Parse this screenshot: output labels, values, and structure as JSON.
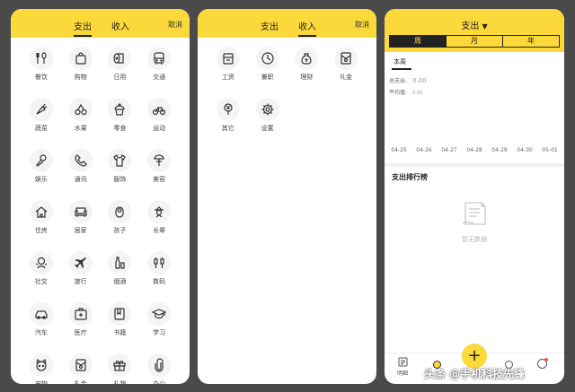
{
  "screen1": {
    "tabs": [
      "支出",
      "收入"
    ],
    "cancel": "取消",
    "categories": [
      {
        "label": "餐饮",
        "icon": "fork-spoon-icon"
      },
      {
        "label": "购物",
        "icon": "shopping-bag-icon"
      },
      {
        "label": "日用",
        "icon": "toilet-paper-icon"
      },
      {
        "label": "交通",
        "icon": "bus-icon"
      },
      {
        "label": "蔬菜",
        "icon": "carrot-icon"
      },
      {
        "label": "水果",
        "icon": "cherries-icon"
      },
      {
        "label": "零食",
        "icon": "cupcake-icon"
      },
      {
        "label": "运动",
        "icon": "bicycle-icon"
      },
      {
        "label": "娱乐",
        "icon": "microphone-icon"
      },
      {
        "label": "通讯",
        "icon": "phone-icon"
      },
      {
        "label": "服饰",
        "icon": "tshirt-icon"
      },
      {
        "label": "美容",
        "icon": "cosmetics-icon"
      },
      {
        "label": "住房",
        "icon": "house-icon"
      },
      {
        "label": "居家",
        "icon": "sofa-icon"
      },
      {
        "label": "孩子",
        "icon": "baby-icon"
      },
      {
        "label": "长辈",
        "icon": "elder-icon"
      },
      {
        "label": "社交",
        "icon": "people-icon"
      },
      {
        "label": "旅行",
        "icon": "airplane-icon"
      },
      {
        "label": "烟酒",
        "icon": "bottle-icon"
      },
      {
        "label": "数码",
        "icon": "usb-plug-icon"
      },
      {
        "label": "汽车",
        "icon": "car-icon"
      },
      {
        "label": "医疗",
        "icon": "medical-kit-icon"
      },
      {
        "label": "书籍",
        "icon": "book-icon"
      },
      {
        "label": "学习",
        "icon": "graduation-cap-icon"
      },
      {
        "label": "宠物",
        "icon": "pet-icon"
      },
      {
        "label": "礼金",
        "icon": "red-envelope-icon"
      },
      {
        "label": "礼物",
        "icon": "gift-icon"
      },
      {
        "label": "办公",
        "icon": "paperclip-icon"
      }
    ]
  },
  "screen2": {
    "tabs": [
      "支出",
      "收入"
    ],
    "cancel": "取消",
    "categories": [
      {
        "label": "工资",
        "icon": "wallet-icon"
      },
      {
        "label": "兼职",
        "icon": "clock-icon"
      },
      {
        "label": "理财",
        "icon": "money-bag-icon"
      },
      {
        "label": "礼金",
        "icon": "red-envelope-icon"
      },
      {
        "label": "其它",
        "icon": "coin-tag-icon"
      },
      {
        "label": "设置",
        "icon": "gear-icon"
      }
    ]
  },
  "screen3": {
    "title": "支出",
    "period_tabs": [
      "周",
      "月",
      "年"
    ],
    "period_label": "本周",
    "total_label": "总支出:",
    "total_value": "0.00",
    "avg_label": "平均值:",
    "avg_value": "0.00",
    "dates": [
      "04-25",
      "04-26",
      "04-27",
      "04-28",
      "04-29",
      "04-30",
      "05-01"
    ],
    "ranking_title": "支出排行榜",
    "empty_text": "暂无数据",
    "nav_detail": "明细",
    "watermark": "头条 @手机科技先锋"
  },
  "colors": {
    "accent": "#fcd93b",
    "dark": "#222222"
  }
}
